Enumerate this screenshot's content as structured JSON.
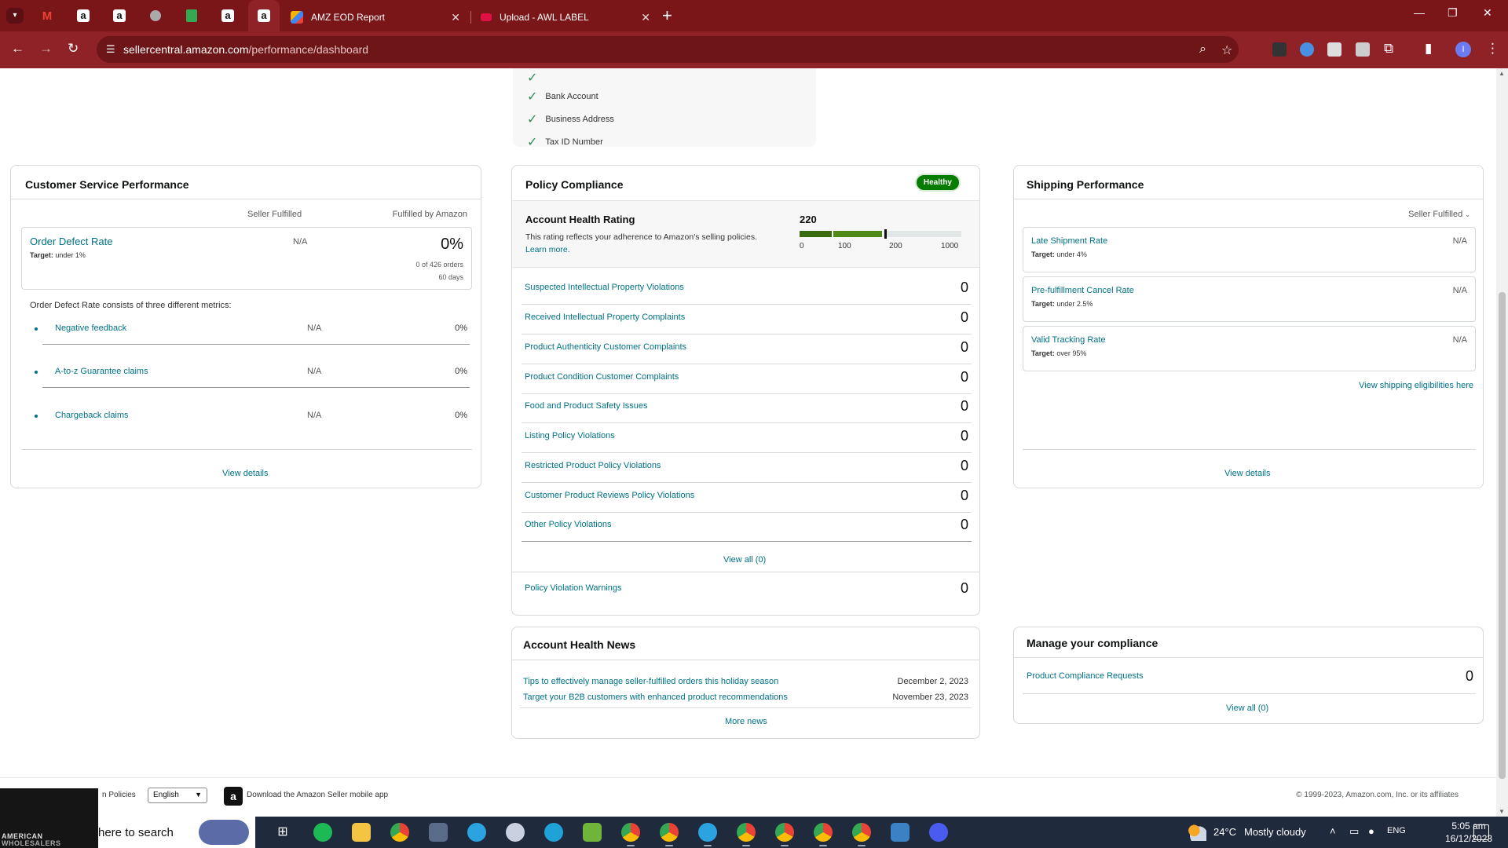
{
  "browser": {
    "tabs": [
      {
        "title": "AMZ EOD Report",
        "active": false
      },
      {
        "title": "Upload - AWL LABEL",
        "active": false
      }
    ],
    "new_tab_icon": "plus-icon",
    "url_host": "sellercentral.amazon.com",
    "url_path": "/performance/dashboard",
    "profile_initial": "I",
    "accent": "#7a1518"
  },
  "verification": {
    "items": [
      "Bank Account",
      "Business Address",
      "Tax ID Number"
    ]
  },
  "customer_service": {
    "title": "Customer Service Performance",
    "col_seller": "Seller Fulfilled",
    "col_amazon": "Fulfilled by Amazon",
    "odr": {
      "name": "Order Defect Rate",
      "target_label": "Target:",
      "target": "under 1%",
      "seller": "N/A",
      "amazon_pct": "0%",
      "orders": "0 of 426 orders",
      "period": "60 days"
    },
    "consists": "Order Defect Rate consists of three different metrics:",
    "metrics": [
      {
        "name": "Negative feedback",
        "seller": "N/A",
        "amazon": "0%"
      },
      {
        "name": "A-to-z Guarantee claims",
        "seller": "N/A",
        "amazon": "0%"
      },
      {
        "name": "Chargeback claims",
        "seller": "N/A",
        "amazon": "0%"
      }
    ],
    "view_details": "View details"
  },
  "policy": {
    "title": "Policy Compliance",
    "status": "Healthy",
    "status_color": "#067d00",
    "rating_title": "Account Health Rating",
    "rating_desc": "This rating reflects your adherence to Amazon's selling policies.",
    "learn_more": "Learn more.",
    "score": "220",
    "gauge_ticks": [
      "0",
      "100",
      "200",
      "1000"
    ],
    "violations": [
      {
        "name": "Suspected Intellectual Property Violations",
        "count": "0"
      },
      {
        "name": "Received Intellectual Property Complaints",
        "count": "0"
      },
      {
        "name": "Product Authenticity Customer Complaints",
        "count": "0"
      },
      {
        "name": "Product Condition Customer Complaints",
        "count": "0"
      },
      {
        "name": "Food and Product Safety Issues",
        "count": "0"
      },
      {
        "name": "Listing Policy Violations",
        "count": "0"
      },
      {
        "name": "Restricted Product Policy Violations",
        "count": "0"
      },
      {
        "name": "Customer Product Reviews Policy Violations",
        "count": "0"
      },
      {
        "name": "Other Policy Violations",
        "count": "0"
      }
    ],
    "view_all": "View all (0)",
    "warnings": {
      "name": "Policy Violation Warnings",
      "count": "0"
    }
  },
  "shipping": {
    "title": "Shipping Performance",
    "filter": "Seller Fulfilled",
    "metrics": [
      {
        "name": "Late Shipment Rate",
        "target": "under 4%",
        "value": "N/A"
      },
      {
        "name": "Pre-fulfillment Cancel Rate",
        "target": "under 2.5%",
        "value": "N/A"
      },
      {
        "name": "Valid Tracking Rate",
        "target": "over 95%",
        "value": "N/A"
      }
    ],
    "target_label": "Target:",
    "eligibilities": "View shipping eligibilities here",
    "view_details": "View details"
  },
  "news": {
    "title": "Account Health News",
    "items": [
      {
        "title": "Tips to effectively manage seller-fulfilled orders this holiday season",
        "date": "December 2, 2023"
      },
      {
        "title": "Target your B2B customers with enhanced product recommendations",
        "date": "November 23, 2023"
      }
    ],
    "more": "More news"
  },
  "compliance": {
    "title": "Manage your compliance",
    "item": "Product Compliance Requests",
    "count": "0",
    "view_all": "View all (0)"
  },
  "footer": {
    "policies": "n Policies",
    "language": "English",
    "app": "Download the Amazon Seller mobile app",
    "copyright": "© 1999-2023, Amazon.com, Inc. or its affiliates"
  },
  "taskbar": {
    "thumb_line1": "AMERICAN",
    "thumb_line2": "WHOLESALERS",
    "search": "here to search",
    "temperature": "24°C",
    "weather": "Mostly cloudy",
    "lang": "ENG",
    "time": "5:05 am",
    "date": "16/12/2023"
  }
}
